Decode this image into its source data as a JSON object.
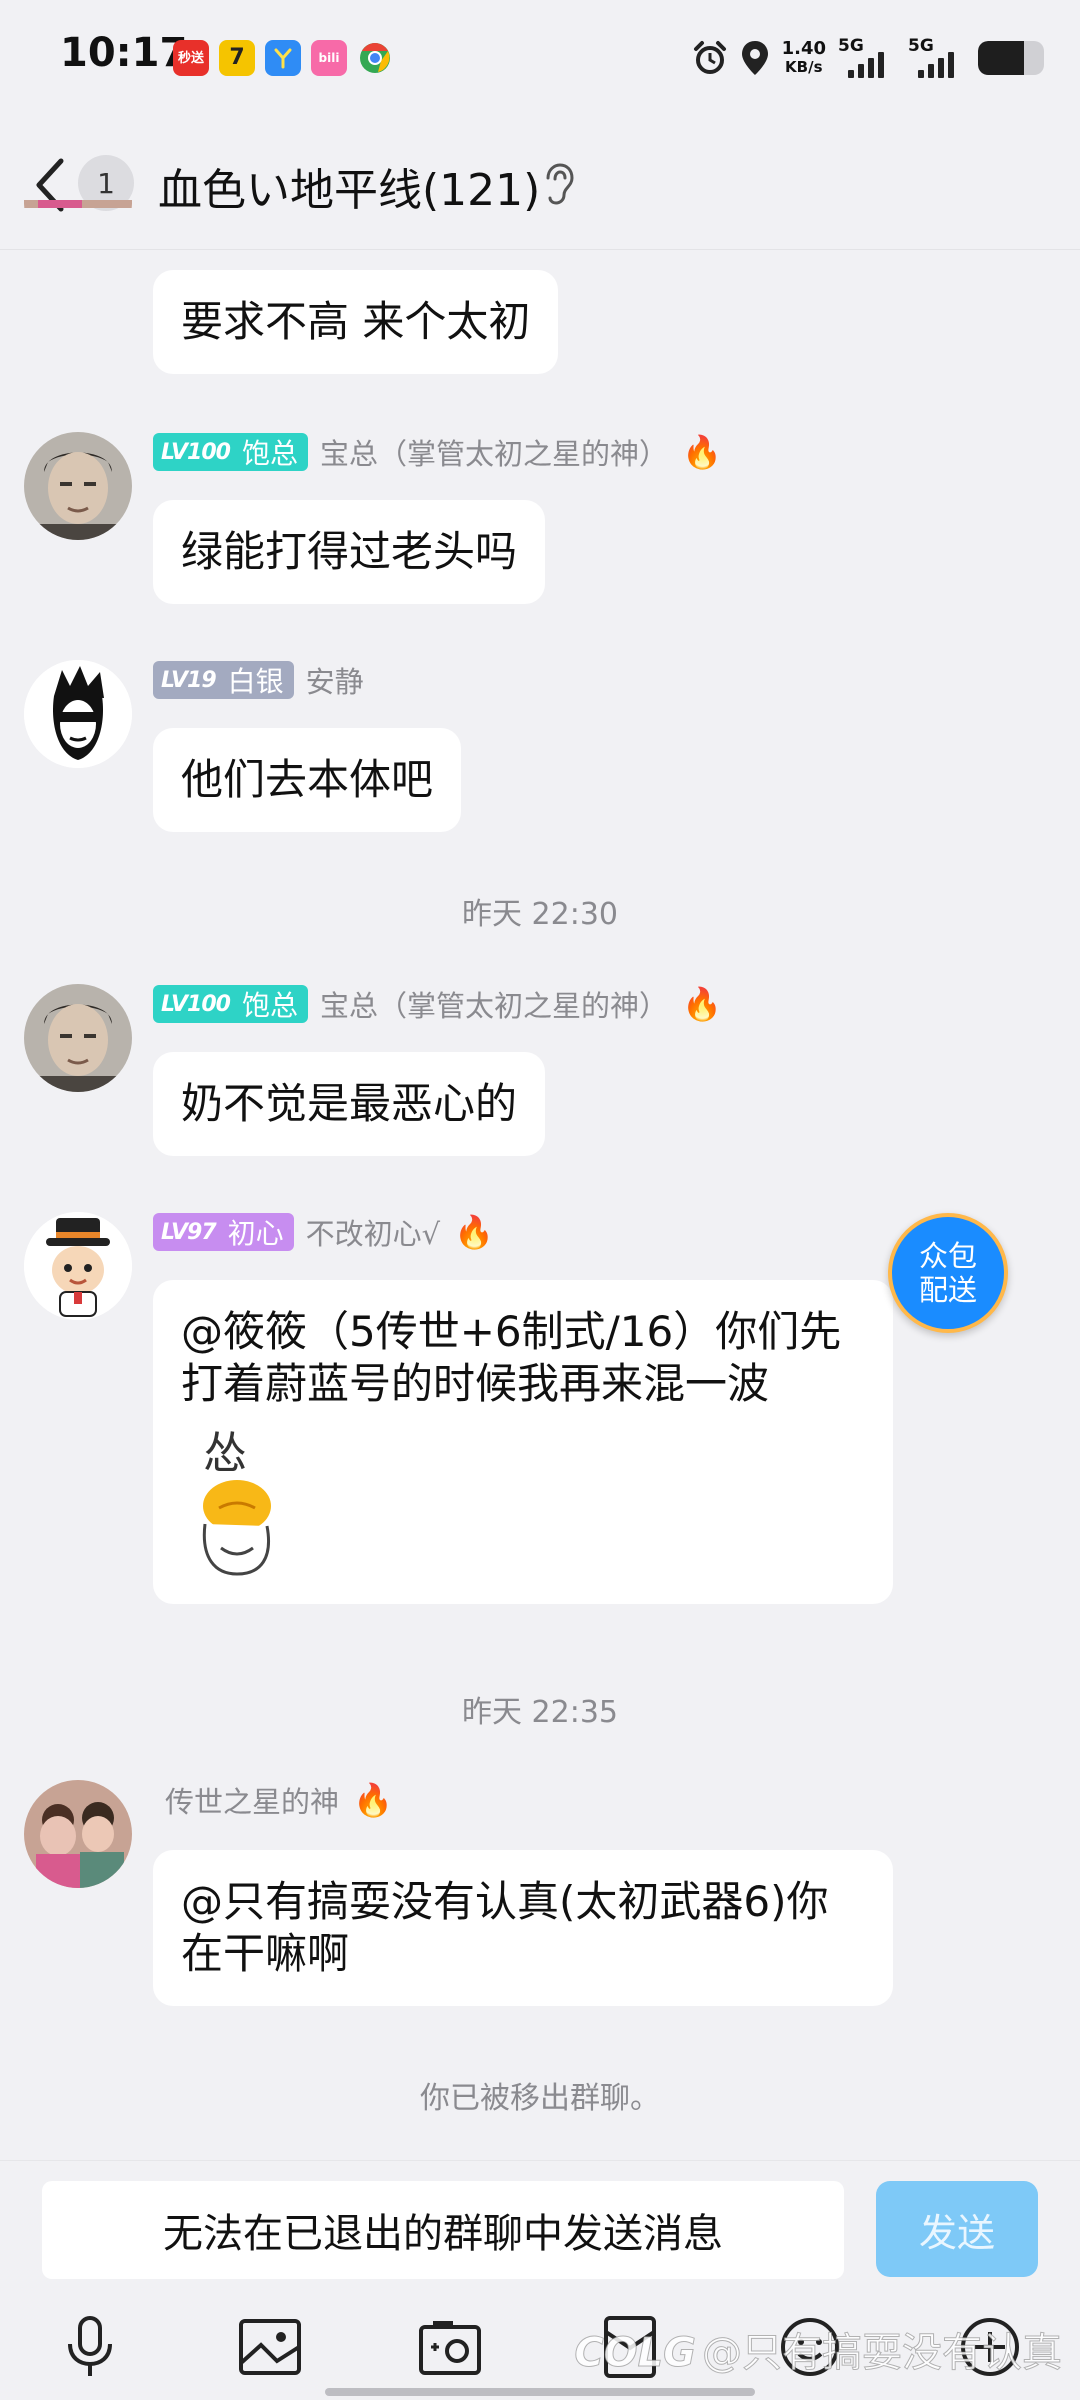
{
  "status_bar": {
    "time": "10:17",
    "network_speed_value": "1.40",
    "network_speed_unit": "KB/s",
    "sim1_label": "5G",
    "sim2_label": "5G",
    "battery_level": 0.7,
    "app_icons": [
      {
        "name": "miaosong-app-icon",
        "text": "秒送",
        "color": "#e8302a"
      },
      {
        "name": "yellow-app-icon",
        "text": "7",
        "color": "#f5c400"
      },
      {
        "name": "blue-app-icon",
        "text": "",
        "color": "#2f8cf5"
      },
      {
        "name": "bilibili-app-icon",
        "text": "bili",
        "color": "#f76aa8"
      },
      {
        "name": "chrome-app-icon",
        "text": "",
        "color": "#ffffff"
      }
    ]
  },
  "header": {
    "unread_count": "1",
    "title": "血色い地平线(121)"
  },
  "messages": [
    {
      "text": "要求不高 来个太初"
    },
    {
      "badge_level": "LV100",
      "badge_title": "饱总",
      "badge_color": "#2ed3c6",
      "nickname": "宝总（掌管太初之星的神）",
      "fire": "🔥",
      "text": "绿能打得过老头吗"
    },
    {
      "badge_level": "LV19",
      "badge_title": "白银",
      "badge_color": "#a3aac0",
      "nickname": "安静",
      "text": "他们去本体吧"
    },
    {
      "badge_level": "LV100",
      "badge_title": "饱总",
      "badge_color": "#2ed3c6",
      "nickname": "宝总（掌管太初之星的神）",
      "fire": "🔥",
      "text": "奶不觉是最恶心的"
    },
    {
      "badge_level": "LV97",
      "badge_title": "初心",
      "badge_color": "#c78df0",
      "nickname": "不改初心√",
      "fire": "🔥",
      "text": "@筱筱（5传世+6制式/16）你们先打着蔚蓝号的时候我再来混一波",
      "sticker_text": "怂"
    },
    {
      "nickname": "传世之星的神",
      "fire": "🔥",
      "text": "@只有搞耍没有认真(太初武器6)你在干嘛啊"
    }
  ],
  "timestamps": [
    "昨天 22:30",
    "昨天 22:35"
  ],
  "system_note": "你已被移出群聊。",
  "floating_button": {
    "line1": "众包",
    "line2": "配送"
  },
  "input": {
    "placeholder": "无法在已退出的群聊中发送消息",
    "send_label": "发送"
  },
  "watermark": {
    "logo": "COLG",
    "text": "@只有搞耍没有认真"
  }
}
